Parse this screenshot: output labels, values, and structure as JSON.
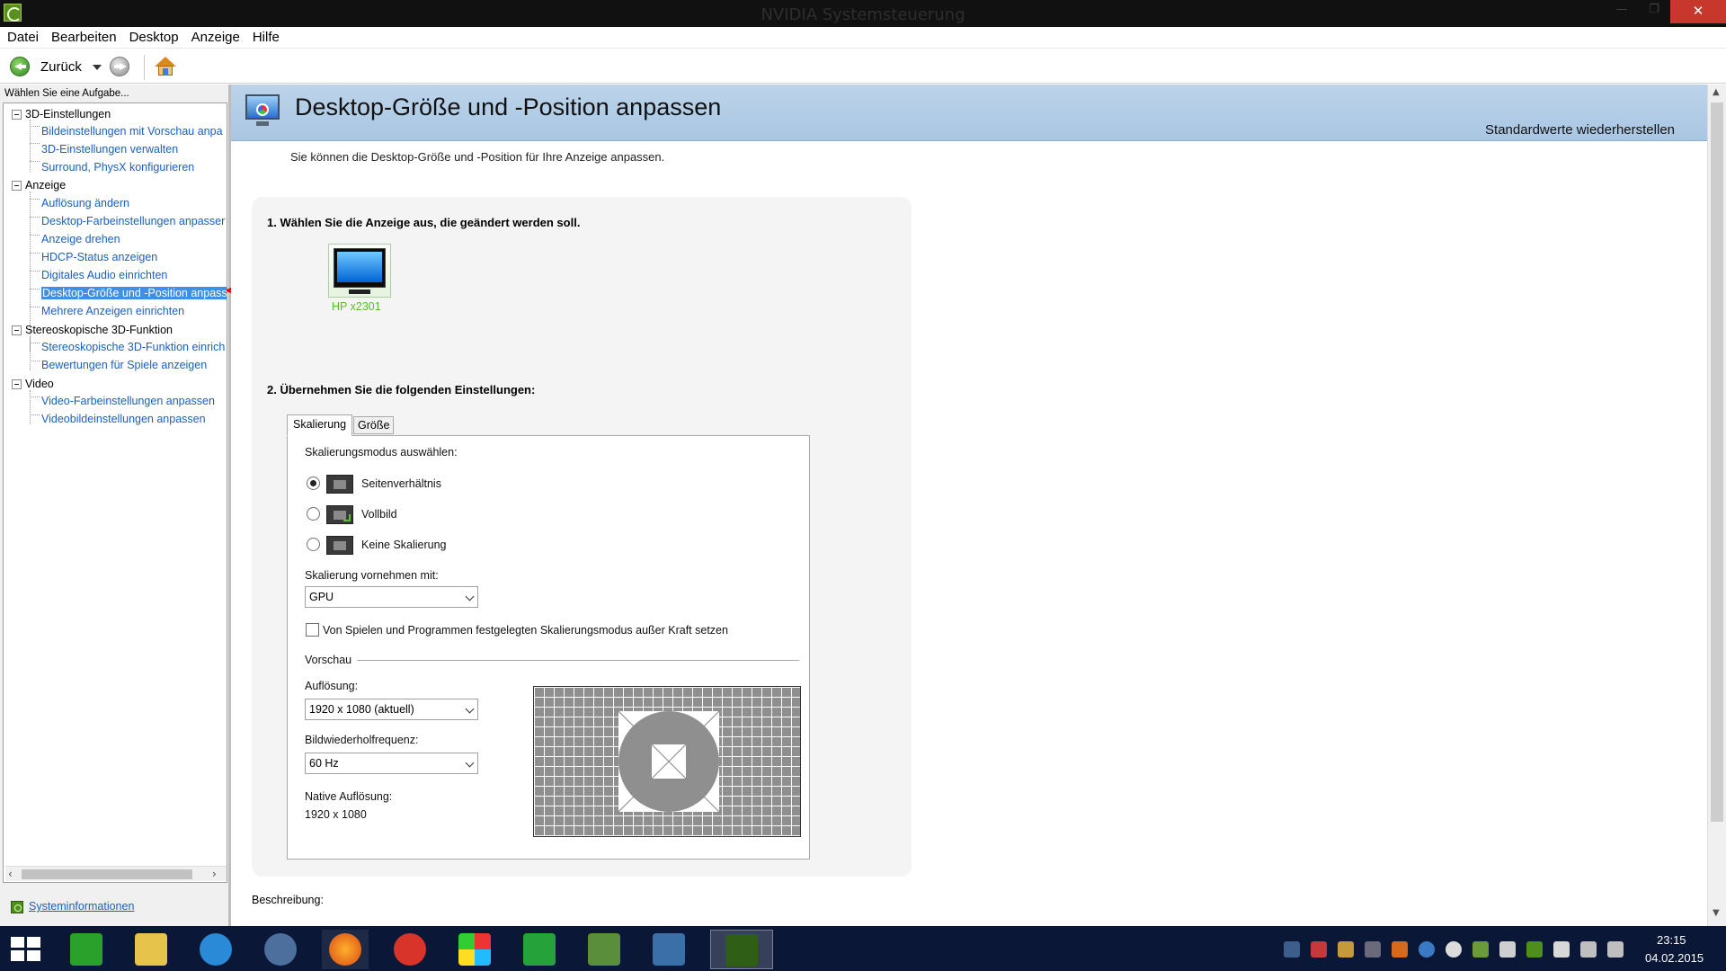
{
  "window": {
    "title": "NVIDIA Systemsteuerung",
    "minimize_glyph": "—",
    "maximize_glyph": "❐",
    "close_glyph": "✕"
  },
  "menu": [
    "Datei",
    "Bearbeiten",
    "Desktop",
    "Anzeige",
    "Hilfe"
  ],
  "toolbar": {
    "back_label": "Zurück"
  },
  "left_pane": {
    "header": "Wählen Sie eine Aufgabe...",
    "groups": [
      {
        "label": "3D-Einstellungen",
        "items": [
          "Bildeinstellungen mit Vorschau anpa",
          "3D-Einstellungen verwalten",
          "Surround, PhysX konfigurieren"
        ]
      },
      {
        "label": "Anzeige",
        "items": [
          "Auflösung ändern",
          "Desktop-Farbeinstellungen anpasser",
          "Anzeige drehen",
          "HDCP-Status anzeigen",
          "Digitales Audio einrichten",
          "Desktop-Größe und -Position anpass",
          "Mehrere Anzeigen einrichten"
        ]
      },
      {
        "label": "Stereoskopische 3D-Funktion",
        "items": [
          "Stereoskopische 3D-Funktion einrich",
          "Bewertungen für Spiele anzeigen"
        ]
      },
      {
        "label": "Video",
        "items": [
          "Video-Farbeinstellungen anpassen",
          "Videobildeinstellungen anpassen"
        ]
      }
    ],
    "selected_item": "Desktop-Größe und -Position anpass",
    "pointer_annotation": "<<<",
    "sysinfo_link": "Systeminformationen",
    "scroll_left": "‹",
    "scroll_right": "›"
  },
  "page": {
    "title": "Desktop-Größe und -Position anpassen",
    "restore_defaults": "Standardwerte wiederherstellen",
    "description": "Sie können die Desktop-Größe und -Position für Ihre Anzeige anpassen.",
    "step1": "1. Wählen Sie die Anzeige aus, die geändert werden soll.",
    "display_name": "HP x2301",
    "step2": "2. Übernehmen Sie die folgenden Einstellungen:",
    "tabs": [
      "Skalierung",
      "Größe"
    ],
    "active_tab": "Skalierung",
    "scaling_mode_label": "Skalierungsmodus auswählen:",
    "scaling_modes": [
      {
        "label": "Seitenverhältnis",
        "selected": true
      },
      {
        "label": "Vollbild",
        "selected": false
      },
      {
        "label": "Keine Skalierung",
        "selected": false
      }
    ],
    "perform_on_label": "Skalierung vornehmen mit:",
    "perform_on_value": "GPU",
    "override_checkbox": {
      "label": "Von Spielen und Programmen festgelegten Skalierungsmodus außer Kraft setzen",
      "checked": false
    },
    "preview_section": "Vorschau",
    "resolution_label": "Auflösung:",
    "resolution_value": "1920 x 1080 (aktuell)",
    "refresh_label": "Bildwiederholfrequenz:",
    "refresh_value": "60 Hz",
    "native_label": "Native Auflösung:",
    "native_value": "1920 x 1080",
    "description_label": "Beschreibung:",
    "scroll_up": "▲",
    "scroll_down": "▼"
  },
  "taskbar": {
    "apps": [
      "start",
      "store",
      "file-explorer",
      "internet-explorer",
      "thunderbird",
      "firefox",
      "ccleaner",
      "pinwheel-app",
      "64-app",
      "green-app",
      "bars-app",
      "nvidia-control-panel"
    ],
    "time": "23:15",
    "date": "04.02.2015"
  }
}
